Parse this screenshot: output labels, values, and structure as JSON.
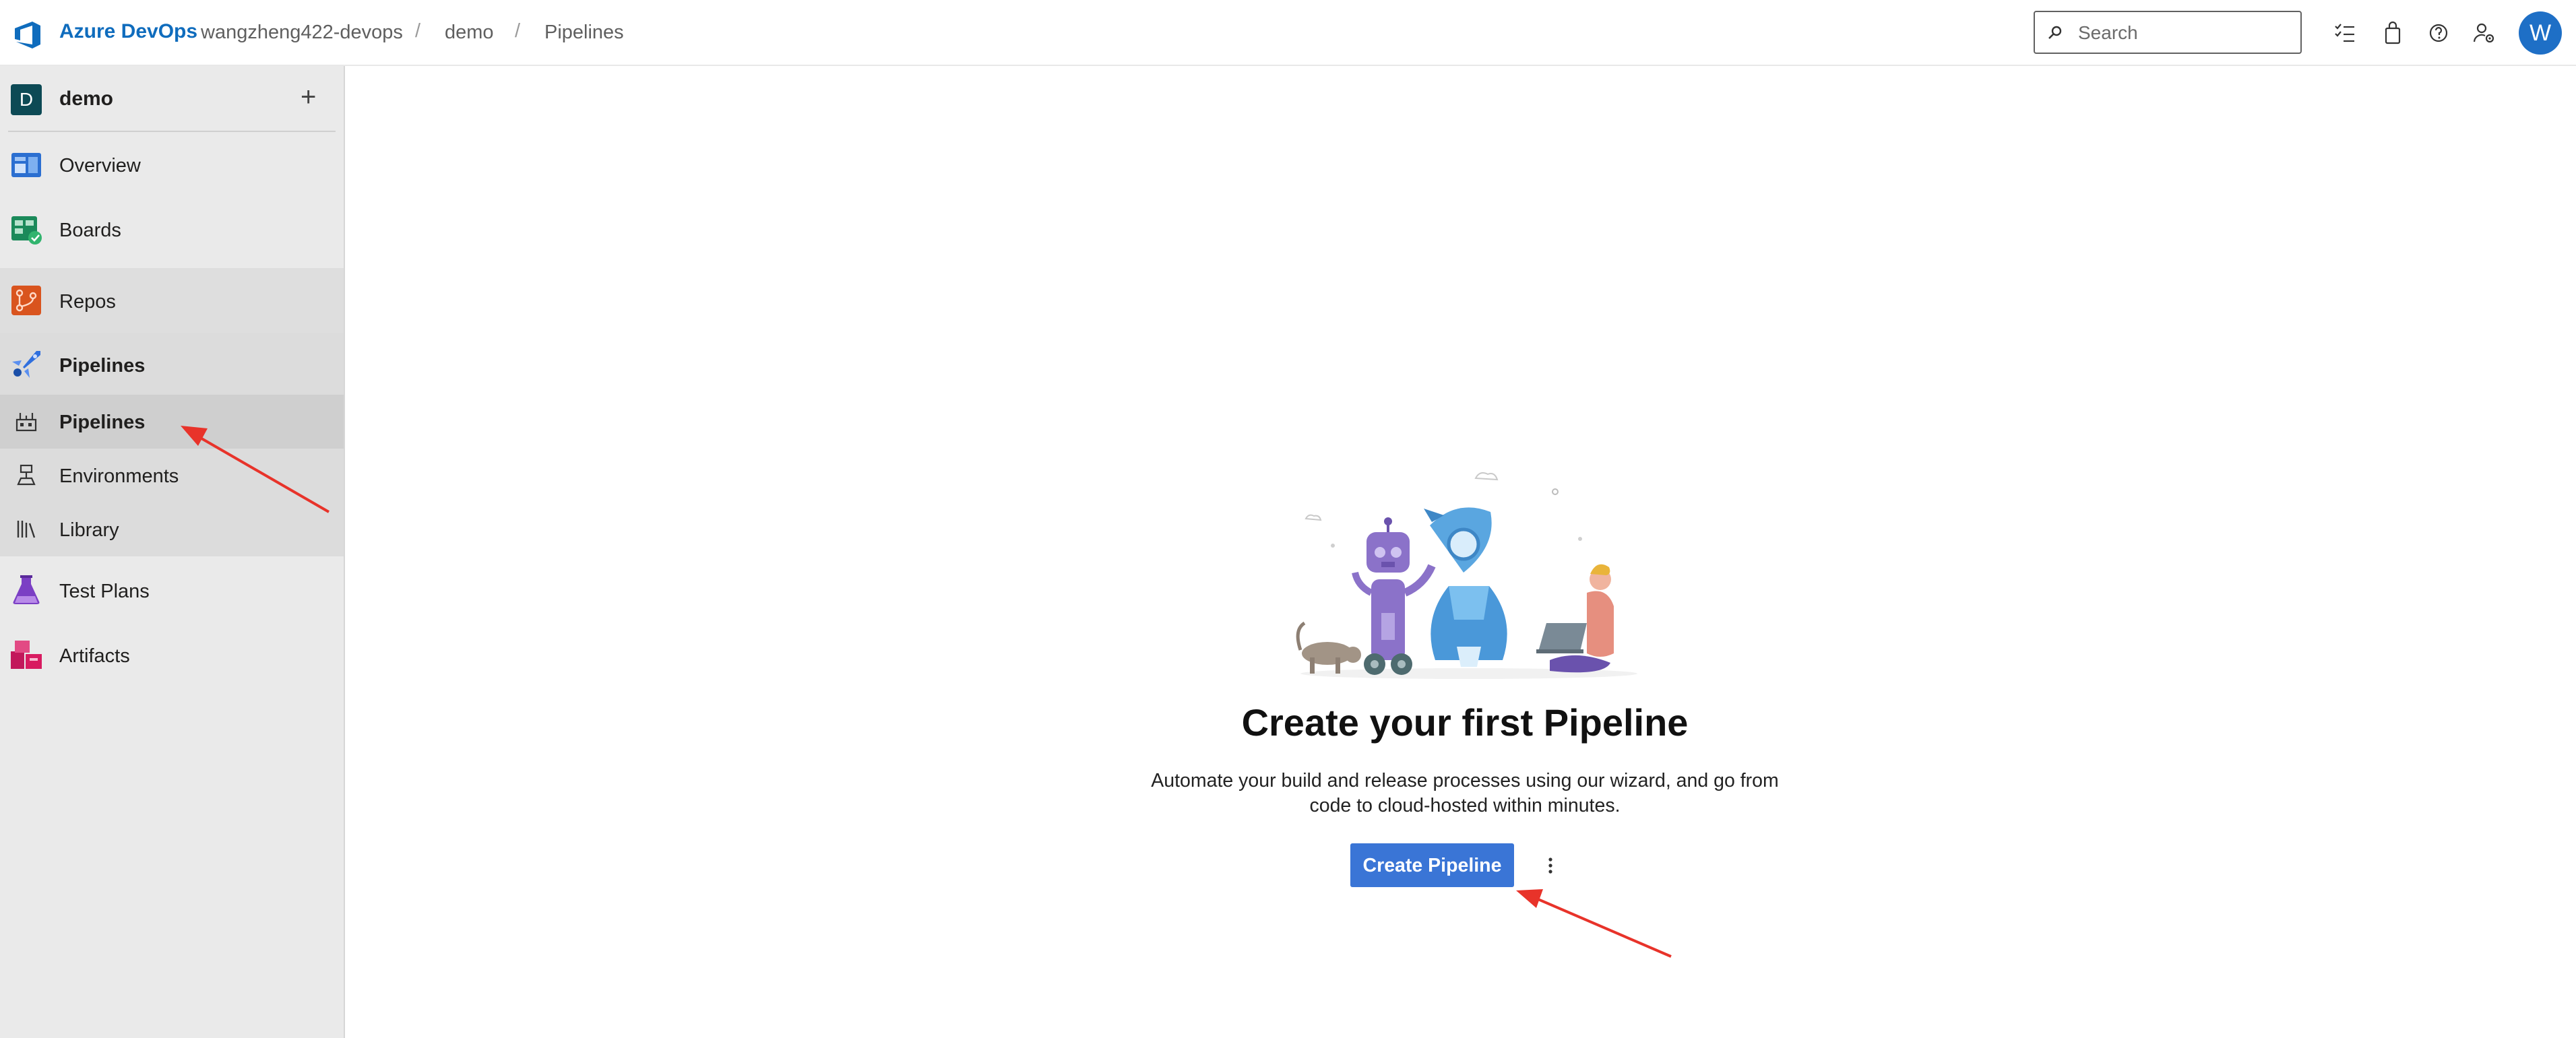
{
  "header": {
    "brand": "Azure DevOps",
    "breadcrumb": [
      "wangzheng422-devops",
      "demo",
      "Pipelines"
    ],
    "breadcrumb_separator": "/",
    "search_placeholder": "Search",
    "icons": [
      "task-list-icon",
      "shopping-bag-icon",
      "help-icon",
      "user-settings-icon"
    ],
    "avatar_initial": "W"
  },
  "sidebar": {
    "project_initial": "D",
    "project_name": "demo",
    "add_symbol": "+",
    "items": [
      {
        "label": "Overview",
        "icon": "overview-icon"
      },
      {
        "label": "Boards",
        "icon": "boards-icon"
      },
      {
        "label": "Repos",
        "icon": "repos-icon"
      },
      {
        "label": "Pipelines",
        "icon": "pipelines-icon",
        "expanded": true
      },
      {
        "label": "Pipelines",
        "icon": "pipelines-sub-icon",
        "selected": true
      },
      {
        "label": "Environments",
        "icon": "environments-icon"
      },
      {
        "label": "Library",
        "icon": "library-icon"
      },
      {
        "label": "Test Plans",
        "icon": "test-plans-icon"
      },
      {
        "label": "Artifacts",
        "icon": "artifacts-icon"
      }
    ]
  },
  "main": {
    "title": "Create your first Pipeline",
    "description": "Automate your build and release processes using our wizard, and go from code to cloud-hosted within minutes.",
    "primary_button": "Create Pipeline",
    "more_icon": "more-vertical-icon"
  },
  "colors": {
    "brand": "#0f6cbd",
    "primary_button": "#3a75d6",
    "sidebar_bg": "#eaeaea",
    "pipelines_section_bg": "#dcdcdc",
    "selected_item_bg": "#cfcfcf",
    "annotation_arrow": "#e8332a",
    "avatar_bg": "#1e6fc6"
  }
}
